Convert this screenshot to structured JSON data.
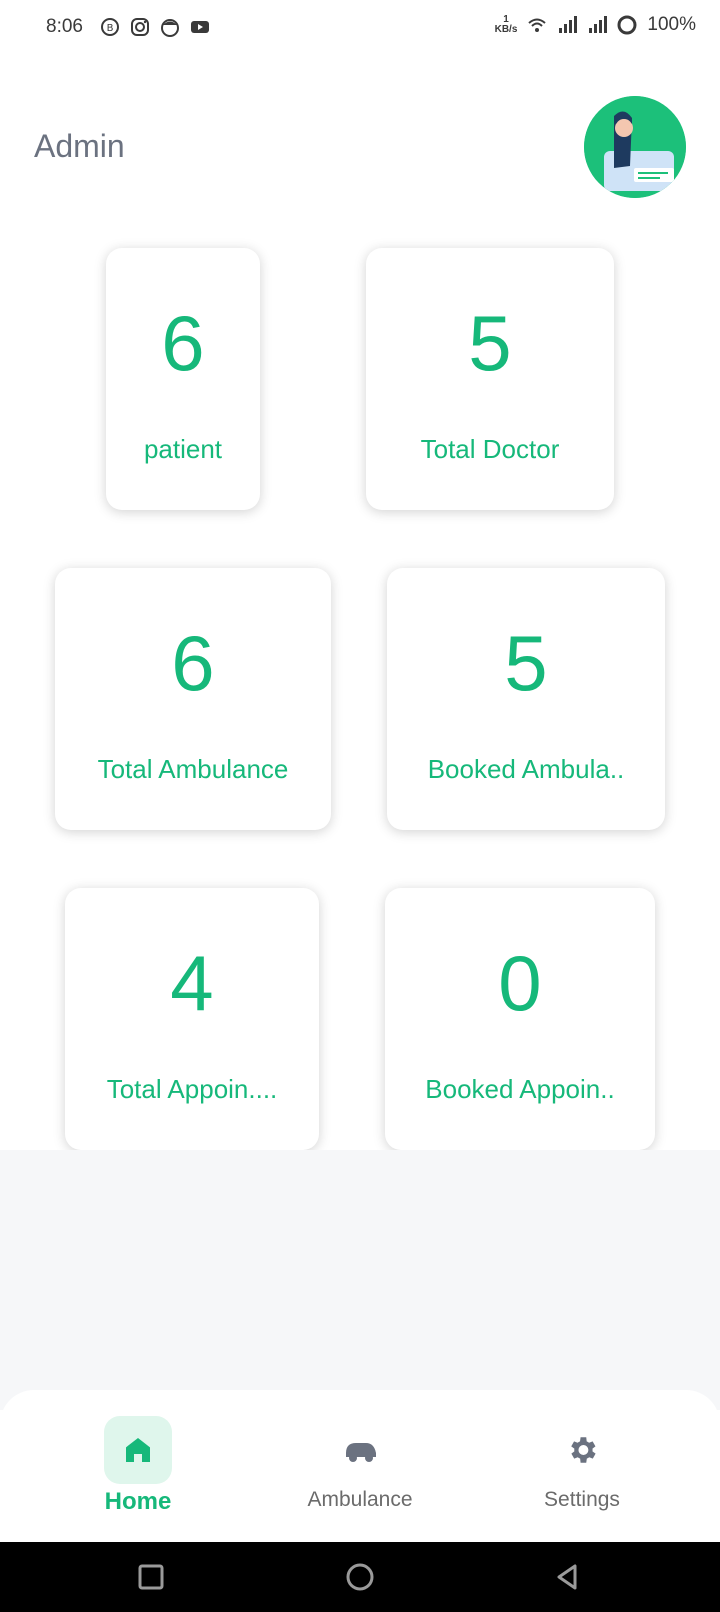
{
  "status_bar": {
    "time": "8:06",
    "network_speed_value": "1",
    "network_speed_unit": "KB/s",
    "battery": "100%"
  },
  "header": {
    "title": "Admin"
  },
  "stats": [
    {
      "value": "6",
      "label": "patient"
    },
    {
      "value": "5",
      "label": "Total Doctor"
    },
    {
      "value": "6",
      "label": "Total Ambulance"
    },
    {
      "value": "5",
      "label": "Booked Ambula.."
    },
    {
      "value": "4",
      "label": "Total Appoin...."
    },
    {
      "value": "0",
      "label": "Booked Appoin.."
    }
  ],
  "bottom_nav": {
    "items": [
      {
        "label": "Home",
        "icon": "home-icon",
        "active": true
      },
      {
        "label": "Ambulance",
        "icon": "ambulance-icon",
        "active": false
      },
      {
        "label": "Settings",
        "icon": "gear-icon",
        "active": false
      }
    ]
  },
  "colors": {
    "accent": "#16b87a",
    "muted": "#6b7280",
    "active_bg": "#dff6ec"
  }
}
